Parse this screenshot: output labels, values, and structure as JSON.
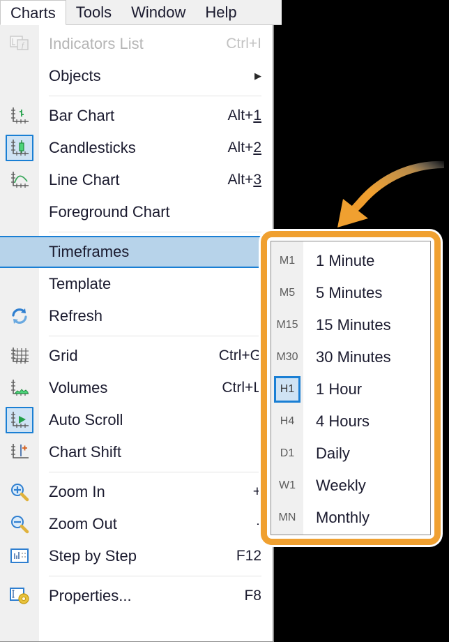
{
  "menubar": {
    "items": [
      {
        "label": "Charts",
        "active": true
      },
      {
        "label": "Tools",
        "active": false
      },
      {
        "label": "Window",
        "active": false
      },
      {
        "label": "Help",
        "active": false
      }
    ]
  },
  "charts_menu": {
    "items": [
      {
        "label": "Indicators List",
        "shortcut": "Ctrl+I",
        "shortcut_underline": "",
        "icon": "indicators-list-icon",
        "disabled": true,
        "boxed": false,
        "submenu_arrow": false
      },
      {
        "label": "Objects",
        "shortcut": "",
        "shortcut_underline": "",
        "icon": "",
        "disabled": false,
        "boxed": false,
        "submenu_arrow": true
      },
      {
        "divider": true
      },
      {
        "label": "Bar Chart",
        "shortcut": "Alt+",
        "shortcut_underline": "1",
        "icon": "bar-chart-icon",
        "disabled": false,
        "boxed": false,
        "submenu_arrow": false
      },
      {
        "label": "Candlesticks",
        "shortcut": "Alt+",
        "shortcut_underline": "2",
        "icon": "candlestick-chart-icon",
        "disabled": false,
        "boxed": true,
        "submenu_arrow": false
      },
      {
        "label": "Line Chart",
        "shortcut": "Alt+",
        "shortcut_underline": "3",
        "icon": "line-chart-icon",
        "disabled": false,
        "boxed": false,
        "submenu_arrow": false
      },
      {
        "label": "Foreground Chart",
        "shortcut": "",
        "shortcut_underline": "",
        "icon": "",
        "disabled": false,
        "boxed": false,
        "submenu_arrow": false
      },
      {
        "divider": true
      },
      {
        "label": "Timeframes",
        "shortcut": "",
        "shortcut_underline": "",
        "icon": "",
        "disabled": false,
        "boxed": false,
        "submenu_arrow": false,
        "highlight": true
      },
      {
        "label": "Template",
        "shortcut": "",
        "shortcut_underline": "",
        "icon": "",
        "disabled": false,
        "boxed": false,
        "submenu_arrow": false
      },
      {
        "label": "Refresh",
        "shortcut": "",
        "shortcut_underline": "",
        "icon": "refresh-icon",
        "disabled": false,
        "boxed": false,
        "submenu_arrow": false
      },
      {
        "divider": true
      },
      {
        "label": "Grid",
        "shortcut": "Ctrl+G",
        "shortcut_underline": "",
        "icon": "grid-icon",
        "disabled": false,
        "boxed": false,
        "submenu_arrow": false
      },
      {
        "label": "Volumes",
        "shortcut": "Ctrl+L",
        "shortcut_underline": "",
        "icon": "volumes-icon",
        "disabled": false,
        "boxed": false,
        "submenu_arrow": false
      },
      {
        "label": "Auto Scroll",
        "shortcut": "",
        "shortcut_underline": "",
        "icon": "auto-scroll-icon",
        "disabled": false,
        "boxed": true,
        "submenu_arrow": false
      },
      {
        "label": "Chart Shift",
        "shortcut": "",
        "shortcut_underline": "",
        "icon": "chart-shift-icon",
        "disabled": false,
        "boxed": false,
        "submenu_arrow": false
      },
      {
        "divider": true
      },
      {
        "label": "Zoom In",
        "shortcut": "+",
        "shortcut_underline": "",
        "icon": "zoom-in-icon",
        "disabled": false,
        "boxed": false,
        "submenu_arrow": false
      },
      {
        "label": "Zoom Out",
        "shortcut": "-",
        "shortcut_underline": "",
        "icon": "zoom-out-icon",
        "disabled": false,
        "boxed": false,
        "submenu_arrow": false
      },
      {
        "label": "Step by Step",
        "shortcut": "F12",
        "shortcut_underline": "",
        "icon": "step-by-step-icon",
        "disabled": false,
        "boxed": false,
        "submenu_arrow": false
      },
      {
        "divider": true
      },
      {
        "label": "Properties...",
        "shortcut": "F8",
        "shortcut_underline": "",
        "icon": "properties-icon",
        "disabled": false,
        "boxed": false,
        "submenu_arrow": false
      }
    ]
  },
  "timeframes_submenu": {
    "items": [
      {
        "code": "M1",
        "label": "1 Minute",
        "selected": false
      },
      {
        "code": "M5",
        "label": "5 Minutes",
        "selected": false
      },
      {
        "code": "M15",
        "label": "15 Minutes",
        "selected": false
      },
      {
        "code": "M30",
        "label": "30 Minutes",
        "selected": false
      },
      {
        "code": "H1",
        "label": "1 Hour",
        "selected": true
      },
      {
        "code": "H4",
        "label": "4 Hours",
        "selected": false
      },
      {
        "code": "D1",
        "label": "Daily",
        "selected": false
      },
      {
        "code": "W1",
        "label": "Weekly",
        "selected": false
      },
      {
        "code": "MN",
        "label": "Monthly",
        "selected": false
      }
    ]
  },
  "annotation": {
    "arrow": "curved-arrow-pointing-to-timeframes-submenu",
    "color": "#f0a030"
  },
  "colors": {
    "accent_orange": "#f0a030",
    "highlight_blue": "#b7d3ea",
    "selection_border": "#1a7fd4",
    "menu_background": "#ffffff",
    "gutter_background": "#f0f0f0",
    "page_background": "#000000",
    "disabled_text": "#b6b6b6",
    "text": "#1a1a2e"
  }
}
